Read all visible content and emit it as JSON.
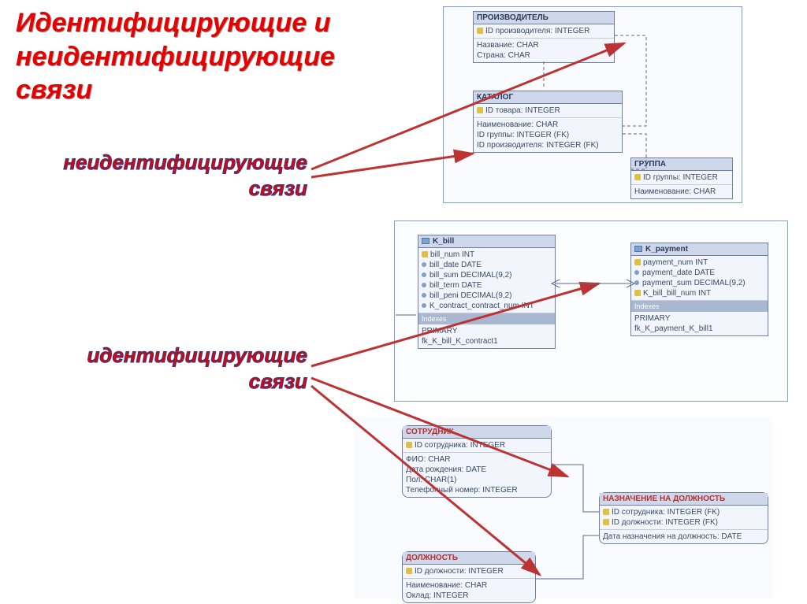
{
  "title": "Идентифицирующие и неидентифицирующие связи",
  "subtitle_nonident": "неидентифицирующие связи",
  "subtitle_ident": "идентифицирующие связи",
  "erd_top": {
    "producer": {
      "name": "ПРОИЗВОДИТЕЛЬ",
      "pk": "ID производителя: INTEGER",
      "attrs": [
        "Название: CHAR",
        "Страна: CHAR"
      ]
    },
    "catalog": {
      "name": "КАТАЛОГ",
      "pk": "ID товара: INTEGER",
      "attrs": [
        "Наименование: CHAR",
        "ID группы: INTEGER (FK)",
        "ID производителя: INTEGER (FK)"
      ]
    },
    "group": {
      "name": "ГРУППА",
      "pk": "ID группы: INTEGER",
      "attrs": [
        "Наименование: CHAR"
      ]
    }
  },
  "erd_mid": {
    "kbill": {
      "name": "K_bill",
      "cols": [
        {
          "k": "key",
          "t": "bill_num INT"
        },
        {
          "k": "dot",
          "t": "bill_date DATE"
        },
        {
          "k": "dot",
          "t": "bill_sum DECIMAL(9,2)"
        },
        {
          "k": "dot",
          "t": "bill_term DATE"
        },
        {
          "k": "dot",
          "t": "bill_peni DECIMAL(9,2)"
        },
        {
          "k": "dot",
          "t": "K_contract_contract_num INT"
        }
      ],
      "indexes_label": "Indexes",
      "indexes": [
        "PRIMARY",
        "fk_K_bill_K_contract1"
      ]
    },
    "kpayment": {
      "name": "K_payment",
      "cols": [
        {
          "k": "key",
          "t": "payment_num INT"
        },
        {
          "k": "dot",
          "t": "payment_date DATE"
        },
        {
          "k": "dot",
          "t": "payment_sum DECIMAL(9,2)"
        },
        {
          "k": "key",
          "t": "K_bill_bill_num INT"
        }
      ],
      "indexes_label": "Indexes",
      "indexes": [
        "PRIMARY",
        "fk_K_payment_K_bill1"
      ]
    }
  },
  "erd_bot": {
    "employee": {
      "name": "СОТРУДНИК",
      "pk": "ID сотрудника: INTEGER",
      "attrs": [
        "ФИО: CHAR",
        "Дата рождения: DATE",
        "Пол: CHAR(1)",
        "Телефонный номер: INTEGER"
      ]
    },
    "assignment": {
      "name": "НАЗНАЧЕНИЕ НА ДОЛЖНОСТЬ",
      "pks": [
        "ID сотрудника: INTEGER (FK)",
        "ID должности: INTEGER (FK)"
      ],
      "attrs": [
        "Дата назначения на должность: DATE"
      ]
    },
    "position": {
      "name": "ДОЛЖНОСТЬ",
      "pk": "ID должности: INTEGER",
      "attrs": [
        "Наименование: CHAR",
        "Оклад: INTEGER"
      ]
    }
  }
}
